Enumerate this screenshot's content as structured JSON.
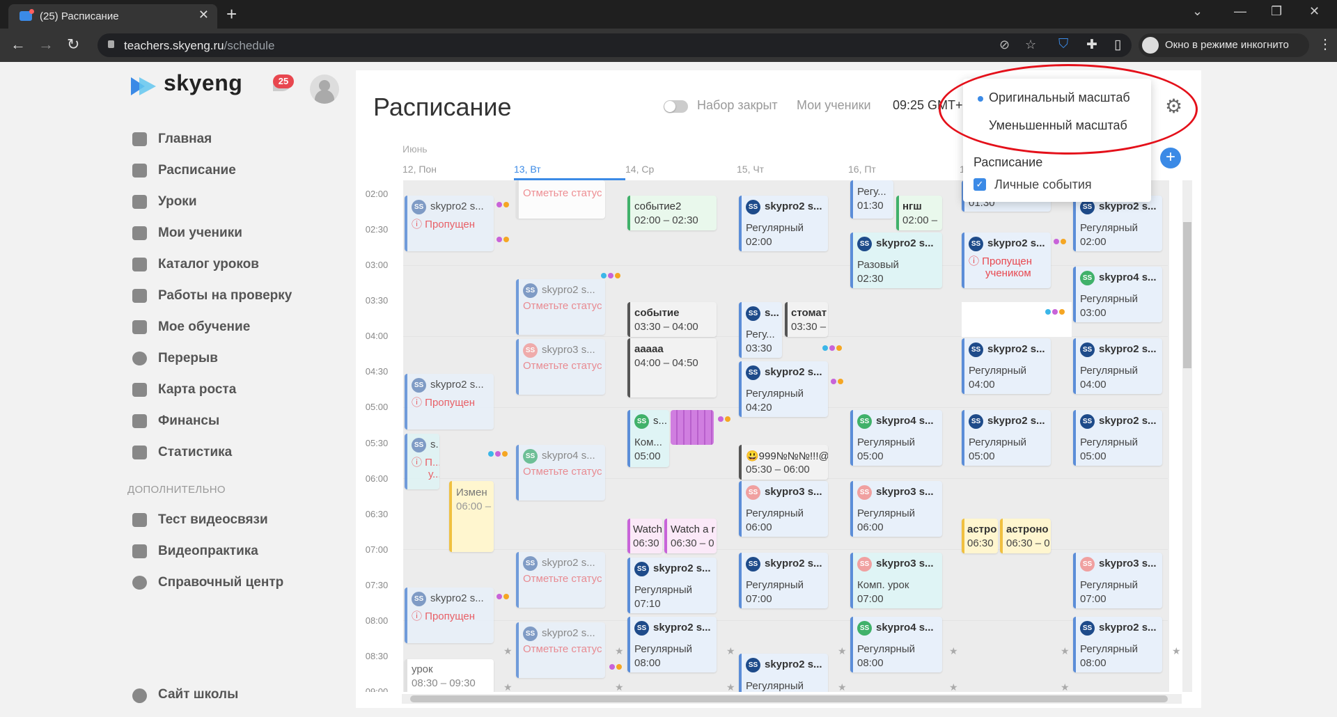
{
  "browser": {
    "tab_title": "(25) Расписание",
    "url_host": "teachers.skyeng.ru",
    "url_path": "/schedule",
    "incognito_label": "Окно в режиме инкогнито"
  },
  "sidebar": {
    "logo": "skyeng",
    "notif_count": "25",
    "items": [
      {
        "label": "Главная",
        "icon": "home-icon"
      },
      {
        "label": "Расписание",
        "icon": "calendar-icon"
      },
      {
        "label": "Уроки",
        "icon": "graduation-cap-icon"
      },
      {
        "label": "Мои ученики",
        "icon": "students-icon"
      },
      {
        "label": "Каталог уроков",
        "icon": "catalog-icon"
      },
      {
        "label": "Работы на проверку",
        "icon": "review-icon"
      },
      {
        "label": "Мое обучение",
        "icon": "learning-icon"
      },
      {
        "label": "Перерыв",
        "icon": "clock-icon"
      },
      {
        "label": "Карта роста",
        "icon": "map-icon"
      },
      {
        "label": "Финансы",
        "icon": "wallet-icon"
      },
      {
        "label": "Статистика",
        "icon": "stats-icon"
      }
    ],
    "section_title": "ДОПОЛНИТЕЛЬНО",
    "extra_items": [
      {
        "label": "Тест видеосвязи",
        "icon": "video-icon"
      },
      {
        "label": "Видеопрактика",
        "icon": "play-icon"
      },
      {
        "label": "Справочный центр",
        "icon": "help-icon"
      }
    ],
    "site_link": "Сайт школы"
  },
  "header": {
    "title": "Расписание",
    "toggle_label": "Набор закрыт",
    "my_students": "Мои ученики",
    "time": "09:25 GMT+("
  },
  "calendar": {
    "month": "Июнь",
    "days": [
      "12, Пон",
      "13, Вт",
      "14, Ср",
      "15, Чт",
      "16, Пт",
      "1"
    ],
    "hours": [
      "02:00",
      "02:30",
      "03:00",
      "03:30",
      "04:00",
      "04:30",
      "05:00",
      "05:30",
      "06:00",
      "06:30",
      "07:00",
      "07:30",
      "08:00",
      "08:30",
      "09:00"
    ]
  },
  "events": {
    "mon": [
      {
        "title": "skypro2 s...",
        "status": "Пропущен"
      },
      {
        "title": "skypro2 s...",
        "status": "Пропущен"
      },
      {
        "title": "s...",
        "status": "П...",
        "status2": "у..."
      },
      {
        "title": "Измен",
        "time": "06:00 –"
      },
      {
        "title": "skypro2 s...",
        "status": "Пропущен"
      },
      {
        "title": "урок",
        "time": "08:30 – 09:30"
      }
    ],
    "tue": [
      {
        "status": "Отметьте статус"
      },
      {
        "title": "skypro2 s...",
        "status": "Отметьте статус"
      },
      {
        "title": "skypro3 s...",
        "status": "Отметьте статус"
      },
      {
        "title": "skypro4 s...",
        "status": "Отметьте статус"
      },
      {
        "title": "skypro2 s...",
        "status": "Отметьте статус"
      },
      {
        "title": "skypro2 s...",
        "status": "Отметьте статус"
      }
    ],
    "wed": [
      {
        "title": "событие2",
        "time": "02:00 – 02:30"
      },
      {
        "title": "событие",
        "time": "03:30 – 04:00"
      },
      {
        "title": "ааааа",
        "time": "04:00 – 04:50"
      },
      {
        "title": "s...",
        "type": "Ком...",
        "time": "05:00"
      },
      {
        "title": "Watch",
        "time": "06:30"
      },
      {
        "title": "Watch a r",
        "time": "06:30 – 0"
      },
      {
        "title": "skypro2 s...",
        "type": "Регулярный",
        "time": "07:10"
      },
      {
        "title": "skypro2 s...",
        "type": "Регулярный",
        "time": "08:00"
      }
    ],
    "thu": [
      {
        "title": "skypro2 s...",
        "type": "Регулярный",
        "time": "02:00"
      },
      {
        "title": "s...",
        "type": "Регу...",
        "time": "03:30"
      },
      {
        "title": "стомат",
        "time": "03:30 –"
      },
      {
        "title": "skypro2 s...",
        "type": "Регулярный",
        "time": "04:20"
      },
      {
        "title": "😃999№№№!!!@",
        "time": "05:30 – 06:00"
      },
      {
        "title": "skypro3 s...",
        "type": "Регулярный",
        "time": "06:00"
      },
      {
        "title": "skypro2 s...",
        "type": "Регулярный",
        "time": "07:00"
      },
      {
        "title": "skypro2 s...",
        "type": "Регулярный"
      }
    ],
    "fri": [
      {
        "type": "Регу...",
        "time": "01:30"
      },
      {
        "title": "нгш",
        "time": "02:00 –"
      },
      {
        "title": "skypro2 s...",
        "type": "Разовый",
        "time": "02:30"
      },
      {
        "title": "skypro4 s...",
        "type": "Регулярный",
        "time": "05:00"
      },
      {
        "title": "skypro3 s...",
        "type": "Регулярный",
        "time": "06:00"
      },
      {
        "title": "skypro3 s...",
        "type": "Комп. урок",
        "time": "07:00"
      },
      {
        "title": "skypro4 s...",
        "type": "Регулярный",
        "time": "08:00"
      }
    ],
    "sat": [
      {
        "time": "01:30"
      },
      {
        "title": "skypro2 s...",
        "status": "Пропущен",
        "status2": "учеником"
      },
      {
        "title": "skypro2 s...",
        "type": "Регулярный",
        "time": "04:00"
      },
      {
        "title": "skypro2 s...",
        "type": "Регулярный",
        "time": "05:00"
      },
      {
        "title": "астро",
        "time": "06:30"
      },
      {
        "title": "астроно",
        "time": "06:30 – 0"
      }
    ],
    "sun": [
      {
        "title": "skypro2 s...",
        "type": "Регулярный",
        "time": "02:00"
      },
      {
        "title": "skypro4 s...",
        "type": "Регулярный",
        "time": "03:00"
      },
      {
        "title": "skypro2 s...",
        "type": "Регулярный",
        "time": "04:00"
      },
      {
        "title": "skypro2 s...",
        "type": "Регулярный",
        "time": "05:00"
      },
      {
        "title": "skypro3 s...",
        "type": "Регулярный",
        "time": "07:00"
      },
      {
        "title": "skypro2 s...",
        "type": "Регулярный",
        "time": "08:00"
      }
    ]
  },
  "avatar_text": "SS",
  "popup": {
    "opt_original": "Оригинальный масштаб",
    "opt_reduced": "Уменьшенный масштаб",
    "section": "Расписание",
    "checkbox_label": "Личные события",
    "checkbox_checked": true
  },
  "colors": {
    "accent": "#3b8ae6",
    "missed": "#e8474f",
    "annotation": "#e4101a"
  }
}
